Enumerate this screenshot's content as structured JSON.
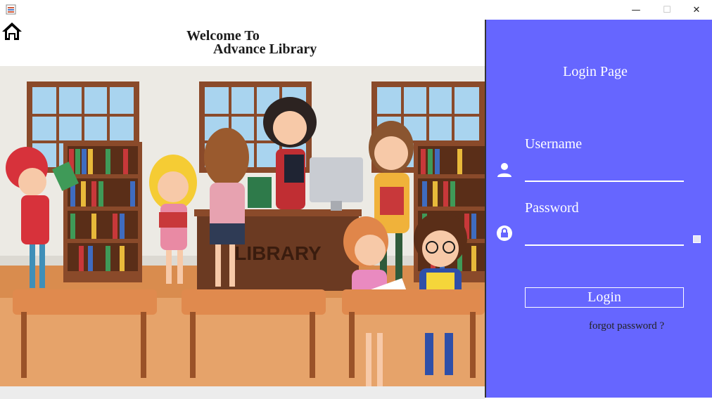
{
  "window": {
    "minimize_glyph": "—",
    "maximize_glyph": "☐",
    "close_glyph": "✕"
  },
  "header": {
    "welcome_line1": "Welcome To",
    "welcome_line2": "Advance Library"
  },
  "scene": {
    "sign_text": "LIBRARY"
  },
  "login": {
    "title": "Login Page",
    "username_label": "Username",
    "username_value": "",
    "password_label": "Password",
    "password_value": "",
    "button_label": "Login",
    "forgot_label": "forgot password ?"
  },
  "colors": {
    "panel": "#6666ff",
    "text": "#ffffff",
    "forgot": "#222222"
  }
}
